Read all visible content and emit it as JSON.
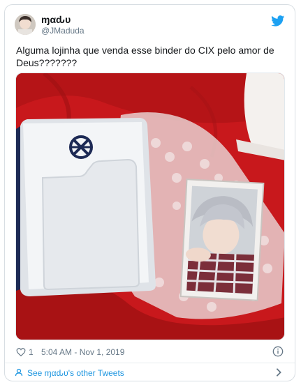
{
  "user": {
    "display_name": "ɱαԃυ",
    "handle": "@JMaduda"
  },
  "tweet": {
    "text": "Alguma lojinha que venda esse binder do CIX pelo amor de Deus???????",
    "likes": "1",
    "timestamp": "5:04 AM - Nov 1, 2019"
  },
  "footer": {
    "link_text": "See ɱαԃυ's other Tweets"
  },
  "icons": {
    "brand": "twitter-bird-icon",
    "like": "heart-icon",
    "info": "info-icon",
    "profile": "user-icon",
    "chevron": "chevron-right-icon"
  },
  "colors": {
    "accent": "#1da1f2",
    "link": "#1b95e0",
    "muted": "#657786"
  }
}
